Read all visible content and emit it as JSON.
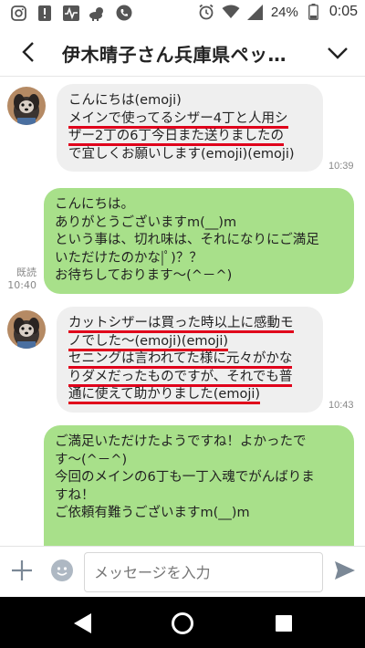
{
  "status_bar": {
    "battery_percent": "24%",
    "clock": "0:05",
    "icons": [
      "instagram-icon",
      "alert-icon",
      "activity-icon",
      "weather-icon",
      "phone-icon",
      "alarm-icon",
      "wifi-icon",
      "signal-icon",
      "battery-icon"
    ]
  },
  "header": {
    "title": "伊木晴子さん兵庫県ペッ…",
    "back_icon": "chevron-left-icon",
    "menu_icon": "chevron-down-icon"
  },
  "messages": [
    {
      "direction": "incoming",
      "lines": [
        "こんにちは(emoji)",
        "メインで使ってるシザー4丁と人用シ",
        "ザー2丁の6丁今日また送りましたの",
        "で宜しくお願いします(emoji)(emoji)"
      ],
      "time": "10:39"
    },
    {
      "direction": "outgoing",
      "lines": [
        "こんにちは。",
        "ありがとうございますm(__)m",
        "という事は、切れ味は、それになりにご満足",
        "いただけたのかな|ﾟ)？？",
        "お待ちしております～(^－^)"
      ],
      "read": "既読",
      "time": "10:40"
    },
    {
      "direction": "incoming",
      "lines": [
        "カットシザーは買った時以上に感動モ",
        "ノでした～(emoji)(emoji)",
        "セニングは言われてた様に元々がかな",
        "りダメだったものですが、それでも普",
        "通に使えて助かりました(emoji)"
      ],
      "time": "10:43"
    },
    {
      "direction": "outgoing",
      "lines": [
        "ご満足いただけたようですね！よかったで",
        "す～(^－^)",
        "今回のメインの6丁も一丁入魂でがんばりま",
        "すね！",
        "ご依頼有難うございますm(__)m"
      ]
    }
  ],
  "input": {
    "placeholder": "メッセージを入力"
  },
  "colors": {
    "incoming_bubble": "#efefef",
    "outgoing_bubble": "#a8e08a",
    "underline": "#e0001b"
  }
}
